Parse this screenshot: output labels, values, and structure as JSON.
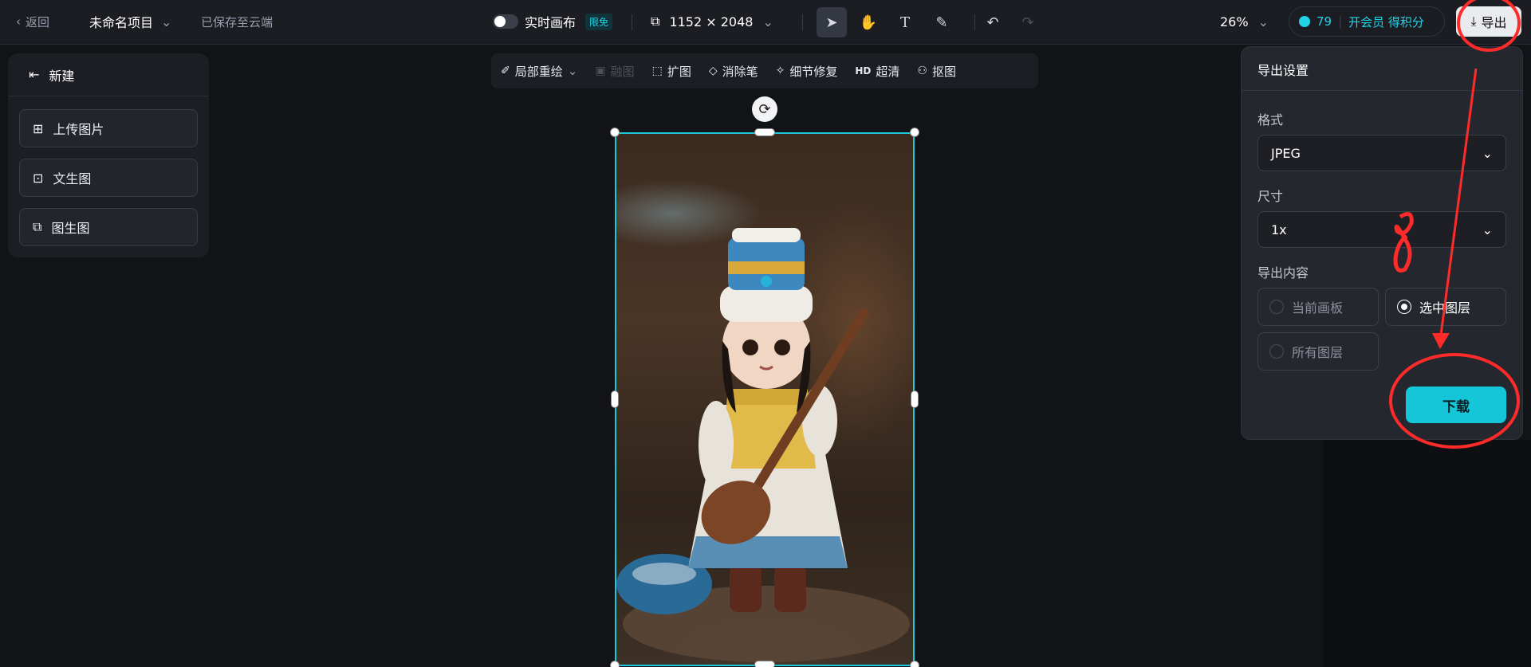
{
  "topbar": {
    "back_label": "返回",
    "project_name": "未命名项目",
    "saved_status": "已保存至云端",
    "live_canvas_label": "实时画布",
    "live_canvas_badge": "限免",
    "canvas_size": "1152 × 2048",
    "zoom": "26%",
    "credits": "79",
    "vip_label": "开会员 得积分",
    "export_label": "导出"
  },
  "left_panel": {
    "new_label": "新建",
    "items": [
      {
        "label": "上传图片",
        "icon": "upload-image-icon"
      },
      {
        "label": "文生图",
        "icon": "text-to-image-icon"
      },
      {
        "label": "图生图",
        "icon": "image-to-image-icon"
      }
    ]
  },
  "float_toolbar": {
    "items": [
      {
        "label": "局部重绘",
        "icon": "repaint-brush-icon",
        "disabled": false
      },
      {
        "label": "融图",
        "icon": "blend-icon",
        "disabled": true
      },
      {
        "label": "扩图",
        "icon": "expand-icon",
        "disabled": false
      },
      {
        "label": "消除笔",
        "icon": "eraser-icon",
        "disabled": false
      },
      {
        "label": "细节修复",
        "icon": "detail-fix-icon",
        "disabled": false
      },
      {
        "label": "超清",
        "icon": "hd-icon",
        "icon_text": "HD",
        "disabled": false
      },
      {
        "label": "抠图",
        "icon": "cutout-icon",
        "disabled": false
      }
    ]
  },
  "export_panel": {
    "title": "导出设置",
    "format_label": "格式",
    "format_value": "JPEG",
    "size_label": "尺寸",
    "size_value": "1x",
    "content_label": "导出内容",
    "options": [
      {
        "label": "当前画板",
        "selected": false
      },
      {
        "label": "选中图层",
        "selected": true
      },
      {
        "label": "所有图层",
        "selected": false
      }
    ],
    "download_label": "下载"
  },
  "colors": {
    "accent": "#15c6d8",
    "annotation": "#ff2a2a"
  }
}
